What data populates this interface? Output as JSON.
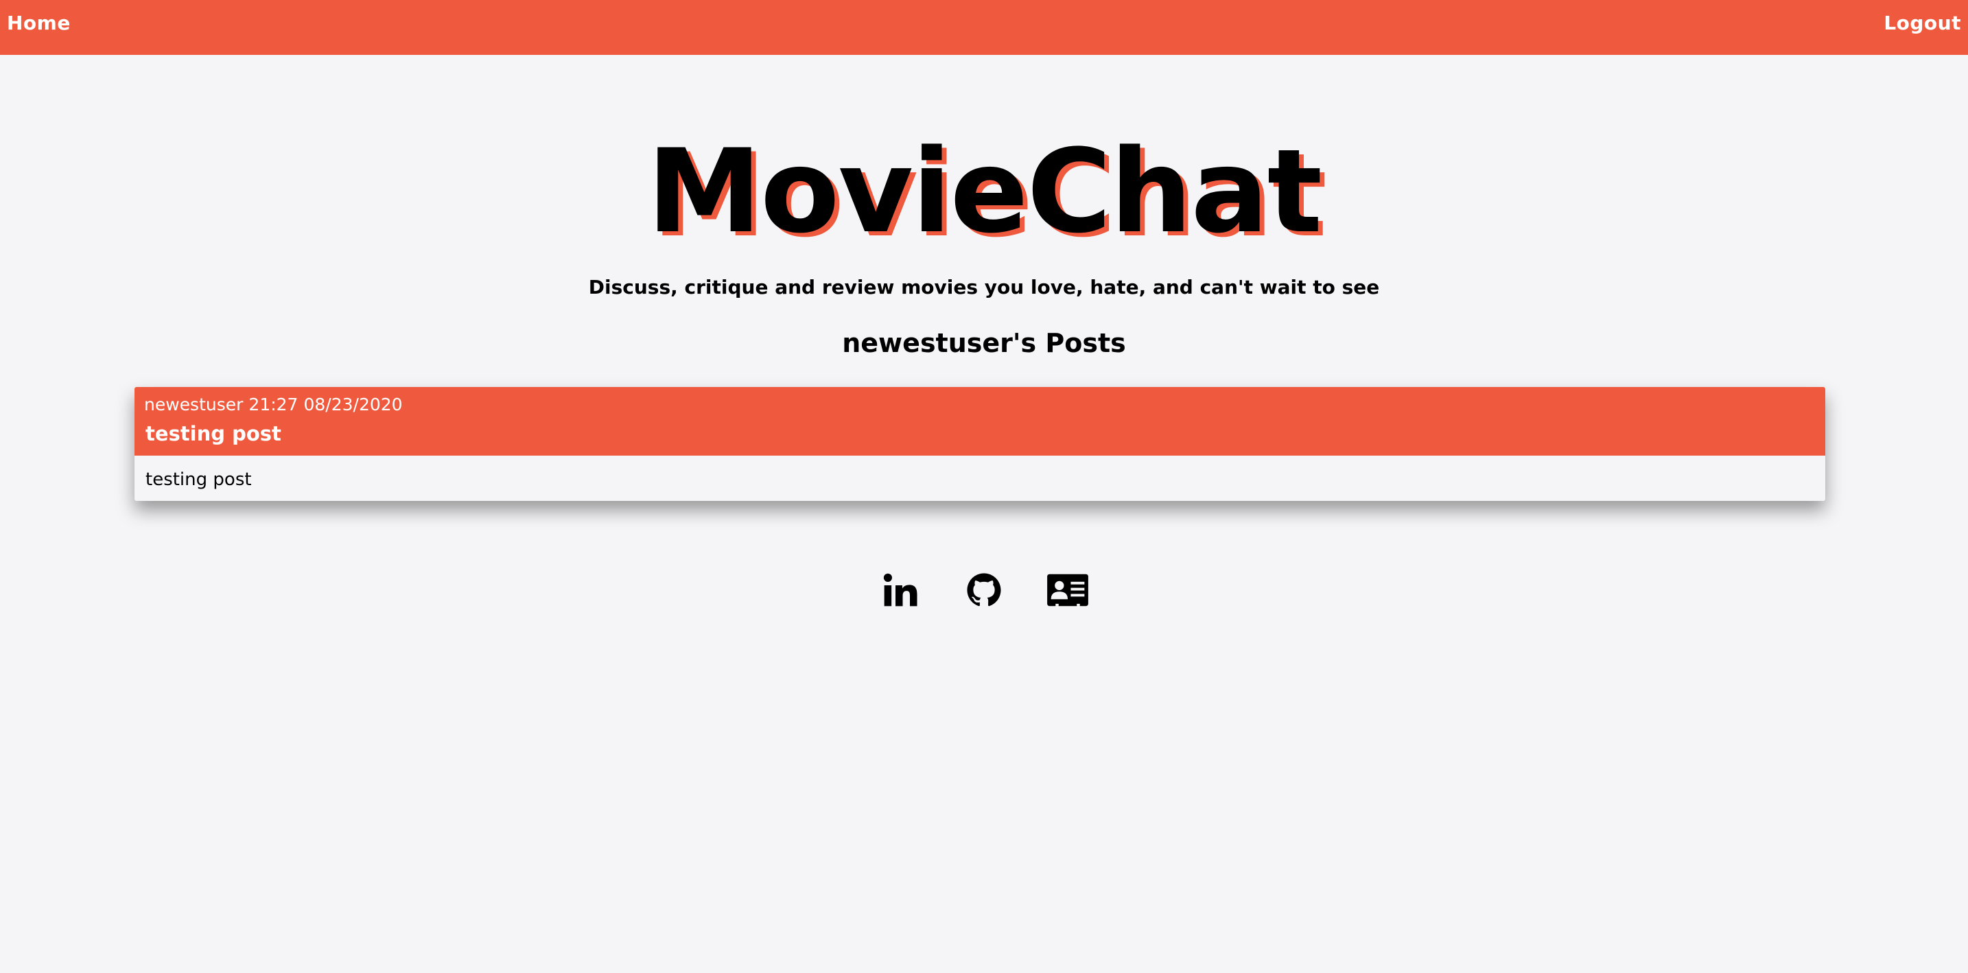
{
  "nav": {
    "home_label": "Home",
    "logout_label": "Logout"
  },
  "hero": {
    "title": "MovieChat",
    "tagline": "Discuss, critique and review movies you love, hate, and can't wait to see"
  },
  "posts_heading": "newestuser's Posts",
  "posts": [
    {
      "author": "newestuser",
      "time": "21:27",
      "date": "08/23/2020",
      "title": "testing post",
      "body": "testing post"
    }
  ],
  "social_icons": [
    "linkedin-icon",
    "github-icon",
    "contact-card-icon"
  ],
  "colors": {
    "accent": "#ef5a3e",
    "background": "#f5f5f7",
    "text": "#000000"
  }
}
